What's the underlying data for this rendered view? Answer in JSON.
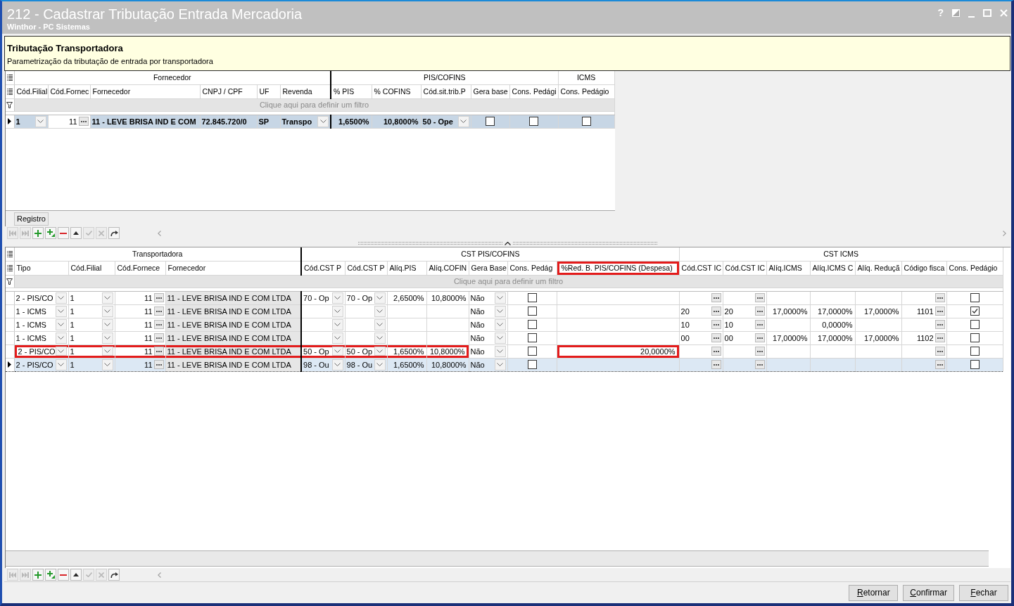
{
  "window": {
    "title": "212 - Cadastrar Tributação Entrada Mercadoria",
    "subtitle": "Winthor - PC Sistemas",
    "help_glyph": "?"
  },
  "header_panel": {
    "title": "Tributação Transportadora",
    "description": "Parametrização da tributação de entrada por transportadora"
  },
  "carrier_grid": {
    "bands": [
      {
        "title": "Fornecedor",
        "columns": [
          {
            "label": "Cód.Filial",
            "kind": "dropdown"
          },
          {
            "label": "Cód.Fornec",
            "kind": "lookup-number"
          },
          {
            "label": "Fornecedor",
            "kind": "text"
          },
          {
            "label": "CNPJ / CPF",
            "kind": "text"
          },
          {
            "label": "UF",
            "kind": "text"
          },
          {
            "label": "Revenda",
            "kind": "dropdown"
          }
        ]
      },
      {
        "title": "PIS/COFINS",
        "columns": [
          {
            "label": "% PIS",
            "kind": "number"
          },
          {
            "label": "% COFINS",
            "kind": "number"
          },
          {
            "label": "Cód.sit.trib.P",
            "kind": "dropdown"
          },
          {
            "label": "Gera base",
            "kind": "checkbox"
          },
          {
            "label": "Cons. Pedági",
            "kind": "checkbox"
          }
        ]
      },
      {
        "title": "ICMS",
        "columns": [
          {
            "label": "Cons. Pedágio",
            "kind": "checkbox"
          }
        ]
      }
    ],
    "filter_prompt": "Clique aqui para definir um filtro",
    "rows": [
      {
        "selected": true,
        "cells": [
          {
            "text": "1",
            "focused": false
          },
          {
            "text": "11",
            "focused": true
          },
          {
            "text": "11 - LEVE BRISA IND E COM",
            "focused": false
          },
          {
            "text": "72.845.720/0",
            "focused": false
          },
          {
            "text": "SP",
            "focused": false
          },
          {
            "text": "Transpo",
            "focused": false
          },
          {
            "text": "1,6500%",
            "focused": false
          },
          {
            "text": "10,8000%",
            "focused": false
          },
          {
            "text": "50 - Ope",
            "focused": false
          },
          {
            "checked": false,
            "focused": false
          },
          {
            "checked": false,
            "focused": false
          },
          {
            "checked": false,
            "focused": false
          }
        ]
      }
    ],
    "record_label": "Registro",
    "navigator": [
      {
        "kind": "first",
        "disabled": true
      },
      {
        "kind": "last",
        "disabled": true
      },
      {
        "kind": "append",
        "disabled": false
      },
      {
        "kind": "insert",
        "disabled": false
      },
      {
        "kind": "delete",
        "disabled": false
      },
      {
        "kind": "edit",
        "disabled": false
      },
      {
        "kind": "post",
        "disabled": true
      },
      {
        "kind": "cancel",
        "disabled": true
      },
      {
        "kind": "refresh",
        "disabled": false
      }
    ]
  },
  "tax_rules_grid": {
    "bands": [
      {
        "title": "Transportadora",
        "columns": [
          {
            "label": "Tipo",
            "kind": "dropdown",
            "framed": false
          },
          {
            "label": "Cód.Filial",
            "kind": "dropdown",
            "framed": false
          },
          {
            "label": "Cód.Fornece",
            "kind": "lookup-number",
            "framed": false
          },
          {
            "label": "Fornecedor",
            "kind": "readonly",
            "framed": false
          }
        ]
      },
      {
        "title": "CST PIS/COFINS",
        "columns": [
          {
            "label": "Cód.CST P",
            "kind": "dropdown",
            "framed": false
          },
          {
            "label": "Cód.CST P",
            "kind": "dropdown",
            "framed": false
          },
          {
            "label": "Alíq.PIS",
            "kind": "number",
            "framed": false
          },
          {
            "label": "Alíq.COFIN",
            "kind": "number",
            "framed": false
          },
          {
            "label": "Gera Base",
            "kind": "dropdown",
            "framed": false
          },
          {
            "label": "Cons. Pedág",
            "kind": "checkbox",
            "framed": false
          },
          {
            "label": "%Red. B. PIS/COFINS (Despesa)",
            "kind": "number",
            "framed": true
          }
        ]
      },
      {
        "title": "CST ICMS",
        "columns": [
          {
            "label": "Cód.CST IC",
            "kind": "lookup",
            "framed": false
          },
          {
            "label": "Cód.CST IC",
            "kind": "lookup",
            "framed": false
          },
          {
            "label": "Alíq.ICMS",
            "kind": "number",
            "framed": false
          },
          {
            "label": "Alíq.ICMS C",
            "kind": "number",
            "framed": false
          },
          {
            "label": "Alíq. Reduçã",
            "kind": "number",
            "framed": false
          },
          {
            "label": "Código fisca",
            "kind": "lookup-number",
            "framed": false
          },
          {
            "label": "Cons. Pedágio",
            "kind": "checkbox",
            "framed": false
          }
        ]
      }
    ],
    "filter_prompt": "Clique aqui para definir um filtro",
    "rows": [
      {
        "selected": false,
        "cells": [
          {
            "text": "2 - PIS/CO",
            "framed": false
          },
          {
            "text": "1",
            "framed": false
          },
          {
            "text": "11",
            "framed": false
          },
          {
            "text": "11 - LEVE BRISA IND E COM LTDA",
            "framed": false
          },
          {
            "text": "70 - Op",
            "framed": false
          },
          {
            "text": "70 - Op",
            "framed": false
          },
          {
            "text": "2,6500%",
            "framed": false
          },
          {
            "text": "10,8000%",
            "framed": false
          },
          {
            "text": "Não",
            "framed": false
          },
          {
            "checked": false,
            "framed": false
          },
          {
            "framed": false
          },
          {
            "framed": false
          },
          {
            "framed": false
          },
          {
            "framed": false
          },
          {
            "framed": false
          },
          {
            "framed": false
          },
          {
            "framed": false
          },
          {
            "checked": false,
            "framed": false
          }
        ]
      },
      {
        "selected": false,
        "cells": [
          {
            "text": "1 - ICMS",
            "framed": false
          },
          {
            "text": "1",
            "framed": false
          },
          {
            "text": "11",
            "framed": false
          },
          {
            "text": "11 - LEVE BRISA IND E COM LTDA",
            "framed": false
          },
          {
            "framed": false
          },
          {
            "framed": false
          },
          {
            "framed": false
          },
          {
            "framed": false
          },
          {
            "text": "Não",
            "framed": false
          },
          {
            "checked": false,
            "framed": false
          },
          {
            "framed": false
          },
          {
            "text": "20",
            "framed": false
          },
          {
            "text": "20",
            "framed": false
          },
          {
            "text": "17,0000%",
            "framed": false
          },
          {
            "text": "17,0000%",
            "framed": false
          },
          {
            "text": "17,0000%",
            "framed": false
          },
          {
            "text": "1101",
            "framed": false
          },
          {
            "checked": true,
            "framed": false
          }
        ]
      },
      {
        "selected": false,
        "cells": [
          {
            "text": "1 - ICMS",
            "framed": false
          },
          {
            "text": "1",
            "framed": false
          },
          {
            "text": "11",
            "framed": false
          },
          {
            "text": "11 - LEVE BRISA IND E COM LTDA",
            "framed": false
          },
          {
            "framed": false
          },
          {
            "framed": false
          },
          {
            "framed": false
          },
          {
            "framed": false
          },
          {
            "text": "Não",
            "framed": false
          },
          {
            "checked": false,
            "framed": false
          },
          {
            "framed": false
          },
          {
            "text": "10",
            "framed": false
          },
          {
            "text": "10",
            "framed": false
          },
          {
            "framed": false
          },
          {
            "text": "0,0000%",
            "framed": false
          },
          {
            "framed": false
          },
          {
            "framed": false
          },
          {
            "checked": false,
            "framed": false
          }
        ]
      },
      {
        "selected": false,
        "cells": [
          {
            "text": "1 - ICMS",
            "framed": false
          },
          {
            "text": "1",
            "framed": false
          },
          {
            "text": "11",
            "framed": false
          },
          {
            "text": "11 - LEVE BRISA IND E COM LTDA",
            "framed": false
          },
          {
            "framed": false
          },
          {
            "framed": false
          },
          {
            "framed": false
          },
          {
            "framed": false
          },
          {
            "text": "Não",
            "framed": false
          },
          {
            "checked": false,
            "framed": false
          },
          {
            "framed": false
          },
          {
            "text": "00",
            "framed": false
          },
          {
            "text": "00",
            "framed": false
          },
          {
            "text": "17,0000%",
            "framed": false
          },
          {
            "text": "17,0000%",
            "framed": false
          },
          {
            "text": "17,0000%",
            "framed": false
          },
          {
            "text": "1102",
            "framed": false
          },
          {
            "checked": false,
            "framed": false
          }
        ]
      },
      {
        "selected": false,
        "cells": [
          {
            "text": "2 - PIS/CO",
            "framed": true
          },
          {
            "text": "1",
            "framed": true
          },
          {
            "text": "11",
            "framed": true
          },
          {
            "text": "11 - LEVE BRISA IND E COM LTDA",
            "framed": true
          },
          {
            "text": "50 - Op",
            "framed": true
          },
          {
            "text": "50 - Op",
            "framed": true
          },
          {
            "text": "1,6500%",
            "framed": true
          },
          {
            "text": "10,8000%",
            "framed": true
          },
          {
            "text": "Não",
            "framed": false
          },
          {
            "checked": false,
            "framed": false
          },
          {
            "text": "20,0000%",
            "framed": true
          },
          {
            "framed": false
          },
          {
            "framed": false
          },
          {
            "framed": false
          },
          {
            "framed": false
          },
          {
            "framed": false
          },
          {
            "framed": false
          },
          {
            "checked": false,
            "framed": false
          }
        ]
      },
      {
        "selected": true,
        "cells": [
          {
            "text": "2 - PIS/CO",
            "framed": false
          },
          {
            "text": "1",
            "framed": false
          },
          {
            "text": "11",
            "framed": false
          },
          {
            "text": "11 - LEVE BRISA IND E COM LTDA",
            "framed": false
          },
          {
            "text": "98 - Ou",
            "framed": false
          },
          {
            "text": "98 - Ou",
            "framed": false
          },
          {
            "text": "1,6500%",
            "framed": false
          },
          {
            "text": "10,8000%",
            "framed": false
          },
          {
            "text": "Não",
            "framed": false
          },
          {
            "checked": false,
            "framed": false
          },
          {
            "framed": false
          },
          {
            "framed": false
          },
          {
            "framed": false
          },
          {
            "framed": false
          },
          {
            "framed": false
          },
          {
            "framed": false
          },
          {
            "framed": false
          },
          {
            "checked": false,
            "framed": false
          }
        ]
      }
    ],
    "navigator": [
      {
        "kind": "first",
        "disabled": true
      },
      {
        "kind": "last",
        "disabled": true
      },
      {
        "kind": "append",
        "disabled": false
      },
      {
        "kind": "insert",
        "disabled": false
      },
      {
        "kind": "delete",
        "disabled": false
      },
      {
        "kind": "edit",
        "disabled": false
      },
      {
        "kind": "post",
        "disabled": true
      },
      {
        "kind": "cancel",
        "disabled": true
      },
      {
        "kind": "refresh",
        "disabled": false
      }
    ]
  },
  "buttons": [
    {
      "label": "Retornar",
      "access_key_underlined": true
    },
    {
      "label": "Confirmar",
      "access_key_underlined": true
    },
    {
      "label": "Fechar",
      "access_key_underlined": true
    }
  ]
}
